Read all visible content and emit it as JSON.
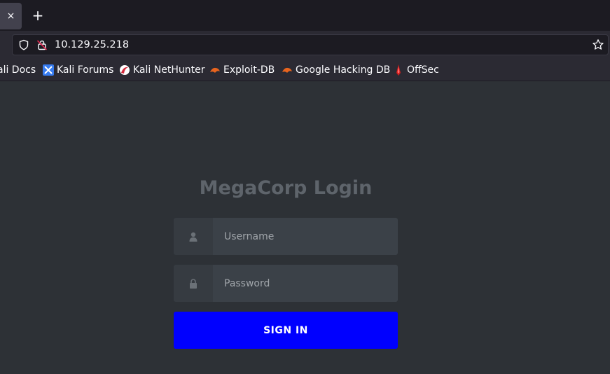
{
  "browser": {
    "tab_close_glyph": "×",
    "new_tab_glyph": "+",
    "url": "10.129.25.218",
    "bookmarks": [
      {
        "label": "ali Docs",
        "icon": "kali-docs-icon"
      },
      {
        "label": "Kali Forums",
        "icon": "kali-forums-icon"
      },
      {
        "label": "Kali NetHunter",
        "icon": "nethunter-icon"
      },
      {
        "label": "Exploit-DB",
        "icon": "exploit-db-icon"
      },
      {
        "label": "Google Hacking DB",
        "icon": "ghdb-icon"
      },
      {
        "label": "OffSec",
        "icon": "offsec-icon"
      }
    ]
  },
  "login": {
    "title": "MegaCorp Login",
    "username_placeholder": "Username",
    "username_value": "",
    "password_placeholder": "Password",
    "password_value": "",
    "submit_label": "SIGN IN"
  },
  "colors": {
    "page_bg": "#2d3136",
    "button_bg": "#0000ff",
    "title": "#5e646b"
  }
}
